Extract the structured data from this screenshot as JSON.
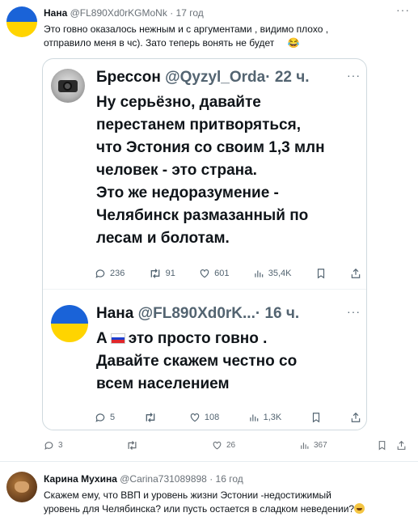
{
  "post1": {
    "name": "Нана",
    "handle": "@FL890Xd0rKGMoNk",
    "separator": "·",
    "time": "17 год",
    "text_line1": "Это говно оказалось нежным и с аргументами , видимо плохо ,",
    "text_line2": "отправило меня в чс). Зато теперь вонять не будет",
    "emoji": "😂",
    "more": "···",
    "actions": {
      "replies": "3",
      "reposts": "",
      "likes": "26",
      "views": "367"
    }
  },
  "embedded": {
    "tweet1": {
      "name": "Брессон",
      "handle": "@Qyzyl_Orda",
      "time": "· 22 ч.",
      "more": "···",
      "lines": [
        "Ну серьёзно, давайте",
        "перестанем притворяться,",
        "что Эстония со своим 1,3 млн",
        "человек - это страна.",
        "Это же недоразумение -",
        "Челябинск размазанный по",
        "лесам и болотам."
      ],
      "actions": {
        "replies": "236",
        "reposts": "91",
        "likes": "601",
        "views": "35,4K"
      }
    },
    "tweet2": {
      "name": "Нана",
      "handle": "@FL890Xd0rK...",
      "time": "· 16 ч.",
      "more": "···",
      "line1_a": "А",
      "line1_b": "это просто говно .",
      "line2": "Давайте скажем честно со",
      "line3": "всем населением",
      "actions": {
        "replies": "5",
        "reposts": "",
        "likes": "108",
        "views": "1,3K"
      }
    }
  },
  "post2": {
    "name": "Карина Мухина",
    "handle": "@Carina731089898",
    "separator": "·",
    "time": "16 год",
    "text_line1": "Скажем ему, что ВВП и уровень жизни Эстонии -недостижимый",
    "text_line2": "уровень для Челябинска? или пусть остается в сладком неведении?"
  },
  "colors": {
    "ua_blue": "#1a63d8",
    "ua_yellow": "#ffd400",
    "muted": "#697077"
  }
}
